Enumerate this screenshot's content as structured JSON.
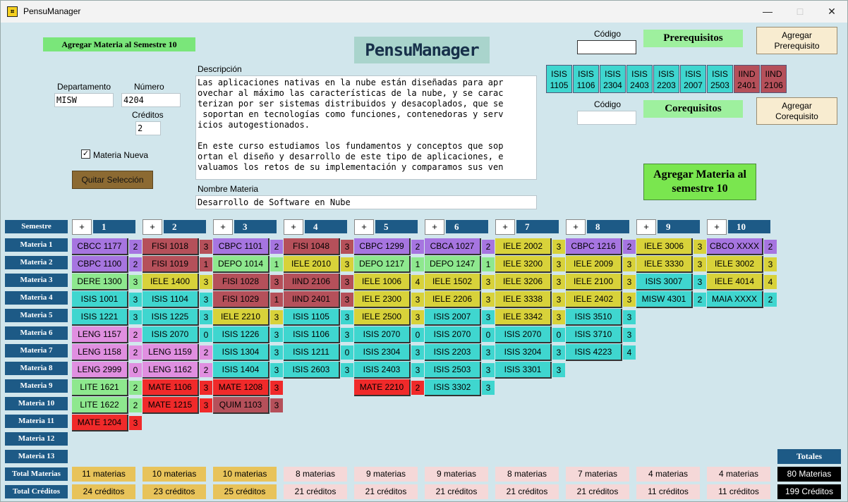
{
  "window": {
    "title": "PensuManager"
  },
  "header": {
    "add_to_sem_label": "Agregar Materia al Semestre 10",
    "logo": "PensuManager"
  },
  "form": {
    "departamento_label": "Departamento",
    "departamento_value": "MISW",
    "numero_label": "Número",
    "numero_value": "4204",
    "creditos_label": "Créditos",
    "creditos_value": "2",
    "materia_nueva_label": "Materia Nueva",
    "quitar_label": "Quitar Selección",
    "descripcion_label": "Descripción",
    "descripcion_lines": [
      "Las aplicaciones nativas en la nube están diseñadas para apr",
      "ovechar al máximo las características de la nube, y se carac",
      "terizan por ser sistemas distribuidos y desacoplados, que se",
      " soportan en tecnologías como funciones, contenedoras y serv",
      "icios autogestionados.",
      "",
      "En este curso estudiamos los fundamentos y conceptos que sop",
      "ortan el diseño y desarrollo de este tipo de aplicaciones, e",
      "valuamos los retos de su implementación y comparamos sus ven"
    ],
    "nombre_label": "Nombre Materia",
    "nombre_value": "Desarrollo de Software en Nube"
  },
  "prereq": {
    "codigo_label": "Código",
    "title": "Prerequisitos",
    "add_label_1": "Agregar",
    "add_label_2": "Prerequisito",
    "items": [
      {
        "l1": "ISIS",
        "l2": "1105",
        "color": "#3fd6cf"
      },
      {
        "l1": "ISIS",
        "l2": "1106",
        "color": "#3fd6cf"
      },
      {
        "l1": "ISIS",
        "l2": "2304",
        "color": "#3fd6cf"
      },
      {
        "l1": "ISIS",
        "l2": "2403",
        "color": "#3fd6cf"
      },
      {
        "l1": "ISIS",
        "l2": "2203",
        "color": "#3fd6cf"
      },
      {
        "l1": "ISIS",
        "l2": "2007",
        "color": "#3fd6cf"
      },
      {
        "l1": "ISIS",
        "l2": "2503",
        "color": "#3fd6cf"
      },
      {
        "l1": "IIND",
        "l2": "2401",
        "color": "#b5505a"
      },
      {
        "l1": "IIND",
        "l2": "2106",
        "color": "#b5505a"
      }
    ]
  },
  "coreq": {
    "codigo_label": "Código",
    "title": "Corequisitos",
    "add_label_1": "Agregar",
    "add_label_2": "Corequisito"
  },
  "add_big": {
    "line1": "Agregar Materia al",
    "line2": "semestre 10"
  },
  "grid": {
    "semestre_label": "Semestre",
    "plus": "+",
    "row_labels": [
      "Materia 1",
      "Materia 2",
      "Materia 3",
      "Materia 4",
      "Materia 5",
      "Materia 6",
      "Materia 7",
      "Materia 8",
      "Materia 9",
      "Materia 10",
      "Materia 11",
      "Materia 12",
      "Materia 13"
    ],
    "total_materias_label": "Total Materias",
    "total_creditos_label": "Total Créditos",
    "totales_label": "Totales",
    "semesters": [
      {
        "num": "1",
        "materias": "11 materias",
        "creditos": "24 créditos",
        "tot_color": "#e8c35a",
        "courses": [
          {
            "code": "CBCC 1177",
            "cr": "2",
            "color": "#a675e0"
          },
          {
            "code": "CBPC 1100",
            "cr": "2",
            "color": "#a675e0"
          },
          {
            "code": "DERE 1300",
            "cr": "3",
            "color": "#8ee88e"
          },
          {
            "code": "ISIS 1001",
            "cr": "3",
            "color": "#3fd6cf"
          },
          {
            "code": "ISIS 1221",
            "cr": "3",
            "color": "#3fd6cf"
          },
          {
            "code": "LENG 1157",
            "cr": "2",
            "color": "#e08fe0"
          },
          {
            "code": "LENG 1158",
            "cr": "2",
            "color": "#e08fe0"
          },
          {
            "code": "LENG 2999",
            "cr": "0",
            "color": "#e08fe0"
          },
          {
            "code": "LITE 1621",
            "cr": "2",
            "color": "#8ee88e"
          },
          {
            "code": "LITE 1622",
            "cr": "2",
            "color": "#8ee88e"
          },
          {
            "code": "MATE 1204",
            "cr": "3",
            "color": "#f02a2a"
          }
        ]
      },
      {
        "num": "2",
        "materias": "10 materias",
        "creditos": "23 créditos",
        "tot_color": "#e8c35a",
        "courses": [
          {
            "code": "FISI 1018",
            "cr": "3",
            "color": "#b5505a"
          },
          {
            "code": "FISI 1019",
            "cr": "1",
            "color": "#b5505a"
          },
          {
            "code": "IELE 1400",
            "cr": "3",
            "color": "#d8d23a"
          },
          {
            "code": "ISIS 1104",
            "cr": "3",
            "color": "#3fd6cf"
          },
          {
            "code": "ISIS 1225",
            "cr": "3",
            "color": "#3fd6cf"
          },
          {
            "code": "ISIS 2070",
            "cr": "0",
            "color": "#3fd6cf"
          },
          {
            "code": "LENG 1159",
            "cr": "2",
            "color": "#e08fe0"
          },
          {
            "code": "LENG 1162",
            "cr": "2",
            "color": "#e08fe0"
          },
          {
            "code": "MATE 1106",
            "cr": "3",
            "color": "#f02a2a"
          },
          {
            "code": "MATE 1215",
            "cr": "3",
            "color": "#f02a2a"
          }
        ]
      },
      {
        "num": "3",
        "materias": "10 materias",
        "creditos": "25 créditos",
        "tot_color": "#e8c35a",
        "courses": [
          {
            "code": "CBPC 1101",
            "cr": "2",
            "color": "#a675e0"
          },
          {
            "code": "DEPO 1014",
            "cr": "1",
            "color": "#8ee88e"
          },
          {
            "code": "FISI 1028",
            "cr": "3",
            "color": "#b5505a"
          },
          {
            "code": "FISI 1029",
            "cr": "1",
            "color": "#b5505a"
          },
          {
            "code": "IELE 2210",
            "cr": "3",
            "color": "#d8d23a"
          },
          {
            "code": "ISIS 1226",
            "cr": "3",
            "color": "#3fd6cf"
          },
          {
            "code": "ISIS 1304",
            "cr": "3",
            "color": "#3fd6cf"
          },
          {
            "code": "ISIS 1404",
            "cr": "3",
            "color": "#3fd6cf"
          },
          {
            "code": "MATE 1208",
            "cr": "3",
            "color": "#f02a2a"
          },
          {
            "code": "QUIM 1103",
            "cr": "3",
            "color": "#b5505a"
          }
        ]
      },
      {
        "num": "4",
        "materias": "8 materias",
        "creditos": "21 créditos",
        "tot_color": "#f5d8d8",
        "courses": [
          {
            "code": "FISI 1048",
            "cr": "3",
            "color": "#b5505a"
          },
          {
            "code": "IELE 2010",
            "cr": "3",
            "color": "#d8d23a"
          },
          {
            "code": "IIND 2106",
            "cr": "3",
            "color": "#b5505a"
          },
          {
            "code": "IIND 2401",
            "cr": "3",
            "color": "#b5505a"
          },
          {
            "code": "ISIS 1105",
            "cr": "3",
            "color": "#3fd6cf"
          },
          {
            "code": "ISIS 1106",
            "cr": "3",
            "color": "#3fd6cf"
          },
          {
            "code": "ISIS 1211",
            "cr": "0",
            "color": "#3fd6cf"
          },
          {
            "code": "ISIS 2603",
            "cr": "3",
            "color": "#3fd6cf"
          }
        ]
      },
      {
        "num": "5",
        "materias": "9 materias",
        "creditos": "21 créditos",
        "tot_color": "#f5d8d8",
        "courses": [
          {
            "code": "CBPC 1299",
            "cr": "2",
            "color": "#a675e0"
          },
          {
            "code": "DEPO 1217",
            "cr": "1",
            "color": "#8ee88e"
          },
          {
            "code": "IELE 1006",
            "cr": "4",
            "color": "#d8d23a"
          },
          {
            "code": "IELE 2300",
            "cr": "3",
            "color": "#d8d23a"
          },
          {
            "code": "IELE 2500",
            "cr": "3",
            "color": "#d8d23a"
          },
          {
            "code": "ISIS 2070",
            "cr": "0",
            "color": "#3fd6cf"
          },
          {
            "code": "ISIS 2304",
            "cr": "3",
            "color": "#3fd6cf"
          },
          {
            "code": "ISIS 2403",
            "cr": "3",
            "color": "#3fd6cf"
          },
          {
            "code": "MATE 2210",
            "cr": "2",
            "color": "#f02a2a"
          }
        ]
      },
      {
        "num": "6",
        "materias": "9 materias",
        "creditos": "21 créditos",
        "tot_color": "#f5d8d8",
        "courses": [
          {
            "code": "CBCA 1027",
            "cr": "2",
            "color": "#a675e0"
          },
          {
            "code": "DEPO 1247",
            "cr": "1",
            "color": "#8ee88e"
          },
          {
            "code": "IELE 1502",
            "cr": "3",
            "color": "#d8d23a"
          },
          {
            "code": "IELE 2206",
            "cr": "3",
            "color": "#d8d23a"
          },
          {
            "code": "ISIS 2007",
            "cr": "3",
            "color": "#3fd6cf"
          },
          {
            "code": "ISIS 2070",
            "cr": "0",
            "color": "#3fd6cf"
          },
          {
            "code": "ISIS 2203",
            "cr": "3",
            "color": "#3fd6cf"
          },
          {
            "code": "ISIS 2503",
            "cr": "3",
            "color": "#3fd6cf"
          },
          {
            "code": "ISIS 3302",
            "cr": "3",
            "color": "#3fd6cf"
          }
        ]
      },
      {
        "num": "7",
        "materias": "8 materias",
        "creditos": "21 créditos",
        "tot_color": "#f5d8d8",
        "courses": [
          {
            "code": "IELE 2002",
            "cr": "3",
            "color": "#d8d23a"
          },
          {
            "code": "IELE 3200",
            "cr": "3",
            "color": "#d8d23a"
          },
          {
            "code": "IELE 3206",
            "cr": "3",
            "color": "#d8d23a"
          },
          {
            "code": "IELE 3338",
            "cr": "3",
            "color": "#d8d23a"
          },
          {
            "code": "IELE 3342",
            "cr": "3",
            "color": "#d8d23a"
          },
          {
            "code": "ISIS 2070",
            "cr": "0",
            "color": "#3fd6cf"
          },
          {
            "code": "ISIS 3204",
            "cr": "3",
            "color": "#3fd6cf"
          },
          {
            "code": "ISIS 3301",
            "cr": "3",
            "color": "#3fd6cf"
          }
        ]
      },
      {
        "num": "8",
        "materias": "7 materias",
        "creditos": "21 créditos",
        "tot_color": "#f5d8d8",
        "courses": [
          {
            "code": "CBPC 1216",
            "cr": "2",
            "color": "#a675e0"
          },
          {
            "code": "IELE 2009",
            "cr": "3",
            "color": "#d8d23a"
          },
          {
            "code": "IELE 2100",
            "cr": "3",
            "color": "#d8d23a"
          },
          {
            "code": "IELE 2402",
            "cr": "3",
            "color": "#d8d23a"
          },
          {
            "code": "ISIS 3510",
            "cr": "3",
            "color": "#3fd6cf"
          },
          {
            "code": "ISIS 3710",
            "cr": "3",
            "color": "#3fd6cf"
          },
          {
            "code": "ISIS 4223",
            "cr": "4",
            "color": "#3fd6cf"
          }
        ]
      },
      {
        "num": "9",
        "materias": "4 materias",
        "creditos": "11 créditos",
        "tot_color": "#f5d8d8",
        "courses": [
          {
            "code": "IELE 3006",
            "cr": "3",
            "color": "#d8d23a"
          },
          {
            "code": "IELE 3330",
            "cr": "3",
            "color": "#d8d23a"
          },
          {
            "code": "ISIS 3007",
            "cr": "3",
            "color": "#3fd6cf"
          },
          {
            "code": "MISW 4301",
            "cr": "2",
            "color": "#3fd6cf"
          }
        ]
      },
      {
        "num": "10",
        "materias": "4 materias",
        "creditos": "11 créditos",
        "tot_color": "#f5d8d8",
        "courses": [
          {
            "code": "CBCO XXXX",
            "cr": "2",
            "color": "#a675e0"
          },
          {
            "code": "IELE 3002",
            "cr": "3",
            "color": "#d8d23a"
          },
          {
            "code": "IELE 4014",
            "cr": "4",
            "color": "#d8d23a"
          },
          {
            "code": "MAIA XXXX",
            "cr": "2",
            "color": "#3fd6cf"
          }
        ]
      }
    ],
    "grand_materias": "80 Materias",
    "grand_creditos": "199 Créditos"
  }
}
